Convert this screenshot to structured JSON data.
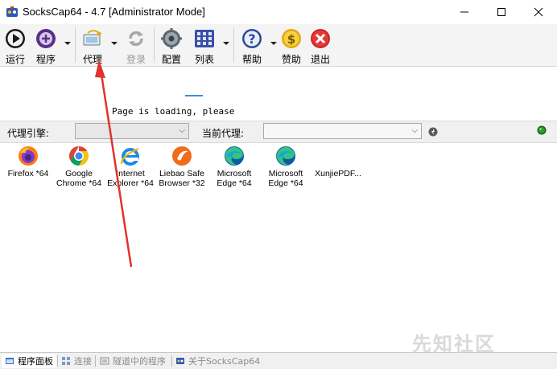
{
  "window": {
    "title": "SocksCap64 - 4.7 [Administrator Mode]"
  },
  "toolbar": {
    "buttons": [
      {
        "label": "运行",
        "icon": "play-icon",
        "enabled": true
      },
      {
        "label": "程序",
        "icon": "add-program-icon",
        "enabled": true
      },
      {
        "label": "代理",
        "icon": "proxy-icon",
        "enabled": true
      },
      {
        "label": "登录",
        "icon": "refresh-login-icon",
        "enabled": false
      },
      {
        "label": "配置",
        "icon": "gear-icon",
        "enabled": true
      },
      {
        "label": "列表",
        "icon": "grid-list-icon",
        "enabled": true
      },
      {
        "label": "帮助",
        "icon": "help-icon",
        "enabled": true
      },
      {
        "label": "赞助",
        "icon": "dollar-icon",
        "enabled": true
      },
      {
        "label": "退出",
        "icon": "exit-icon",
        "enabled": true
      }
    ]
  },
  "page": {
    "loading_text": "Page is loading, please"
  },
  "proxybar": {
    "engine_label": "代理引擎:",
    "engine_value": "",
    "current_label": "当前代理:",
    "current_value": ""
  },
  "programs": [
    {
      "label": "Firefox *64",
      "icon": "firefox-icon"
    },
    {
      "label": "Google\nChrome *64",
      "icon": "chrome-icon"
    },
    {
      "label": "Internet\nExplorer *64",
      "icon": "ie-icon"
    },
    {
      "label": "Liebao Safe\nBrowser *32",
      "icon": "liebao-icon"
    },
    {
      "label": "Microsoft\nEdge *64",
      "icon": "edge-icon"
    },
    {
      "label": "Microsoft\nEdge *64",
      "icon": "edge-icon"
    },
    {
      "label": "XunjiePDF...",
      "icon": "pdf-icon"
    }
  ],
  "tabs": [
    {
      "label": "程序面板",
      "active": true
    },
    {
      "label": "连接",
      "active": false
    },
    {
      "label": "隧道中的程序",
      "active": false
    },
    {
      "label": "关于SocksCap64",
      "active": false
    }
  ],
  "watermark": "先知社区",
  "colors": {
    "annotation_arrow": "#e0332d",
    "status_ok": "#2e9b2e"
  }
}
